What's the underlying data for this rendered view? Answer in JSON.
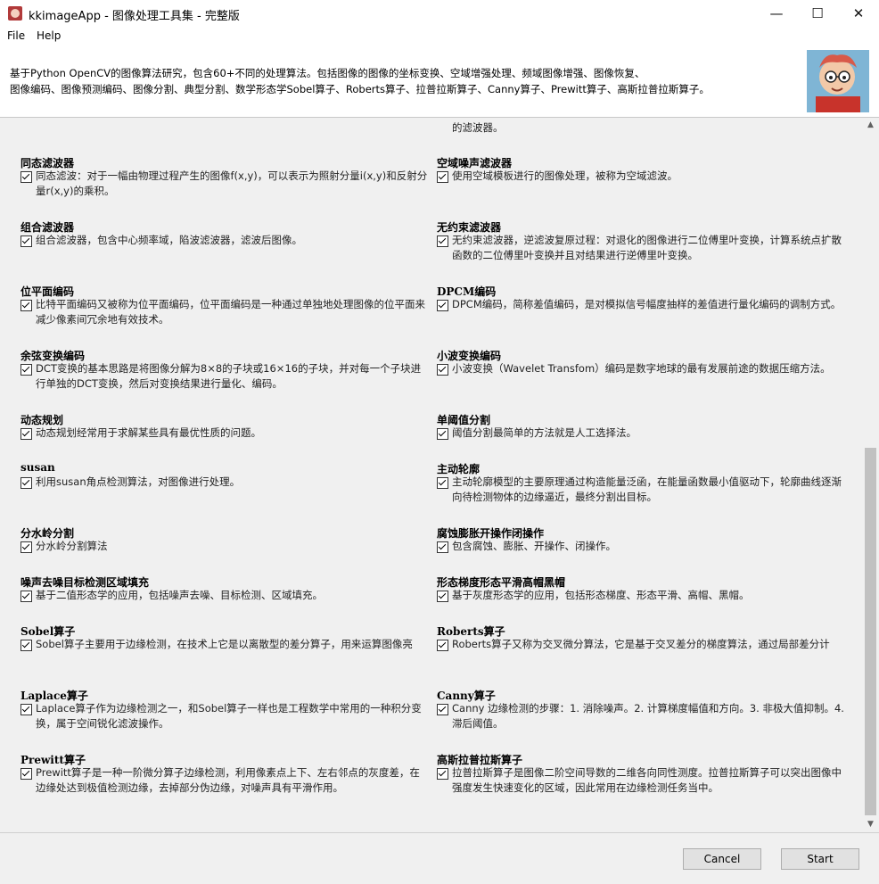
{
  "window": {
    "title": "kkimageApp - 图像处理工具集 - 完整版",
    "minimize": "—",
    "maximize": "☐",
    "close": "✕"
  },
  "menu": {
    "file": "File",
    "help": "Help"
  },
  "description": {
    "line1": "基于Python OpenCV的图像算法研究，包含60+不同的处理算法。包括图像的图像的坐标变换、空域增强处理、频域图像增强、图像恢复、",
    "line2": "图像编码、图像预测编码、图像分割、典型分割、数学形态学Sobel算子、Roberts算子、拉普拉斯算子、Canny算子、Prewitt算子、高斯拉普拉斯算子。"
  },
  "partial_top": "的滤波器。",
  "items_left": [
    {
      "heading": "同态滤波器",
      "text": "同态滤波：对于一幅由物理过程产生的图像f(x,y)，可以表示为照射分量i(x,y)和反射分量r(x,y)的乘积。"
    },
    {
      "heading": "组合滤波器",
      "text": "组合滤波器，包含中心频率域，陷波滤波器，滤波后图像。"
    },
    {
      "heading": "位平面编码",
      "text": "比特平面编码又被称为位平面编码，位平面编码是一种通过单独地处理图像的位平面来减少像素间冗余地有效技术。"
    },
    {
      "heading": "余弦变换编码",
      "text": "DCT变换的基本思路是将图像分解为8×8的子块或16×16的子块，并对每一个子块进行单独的DCT变换，然后对变换结果进行量化、编码。"
    },
    {
      "heading": "动态规划",
      "text": "动态规划经常用于求解某些具有最优性质的问题。"
    },
    {
      "heading": "susan",
      "text": "利用susan角点检测算法，对图像进行处理。"
    },
    {
      "heading": "分水岭分割",
      "text": "分水岭分割算法"
    },
    {
      "heading": "噪声去噪目标检测区域填充",
      "text": "基于二值形态学的应用，包括噪声去噪、目标检测、区域填充。"
    },
    {
      "heading": "Sobel算子",
      "text": "Sobel算子主要用于边缘检测，在技术上它是以离散型的差分算子，用来运算图像亮"
    },
    {
      "heading": "Laplace算子",
      "text": "Laplace算子作为边缘检测之一，和Sobel算子一样也是工程数学中常用的一种积分变换，属于空间锐化滤波操作。"
    },
    {
      "heading": "Prewitt算子",
      "text": "Prewitt算子是一种一阶微分算子边缘检测，利用像素点上下、左右邻点的灰度差，在边缘处达到极值检测边缘，去掉部分伪边缘，对噪声具有平滑作用。"
    }
  ],
  "items_right": [
    {
      "heading": "空域噪声滤波器",
      "text": "使用空域模板进行的图像处理，被称为空域滤波。"
    },
    {
      "heading": "无约束滤波器",
      "text": "无约束滤波器，逆滤波复原过程：对退化的图像进行二位傅里叶变换，计算系统点扩散函数的二位傅里叶变换并且对结果进行逆傅里叶变换。"
    },
    {
      "heading": "DPCM编码",
      "text": "DPCM编码，简称差值编码，是对模拟信号幅度抽样的差值进行量化编码的调制方式。"
    },
    {
      "heading": "小波变换编码",
      "text": "小波变换（Wavelet Transfom）编码是数字地球的最有发展前途的数据压缩方法。"
    },
    {
      "heading": "单阈值分割",
      "text": "阈值分割最简单的方法就是人工选择法。"
    },
    {
      "heading": "主动轮廓",
      "text": "主动轮廓模型的主要原理通过构造能量泛函，在能量函数最小值驱动下，轮廓曲线逐渐向待检测物体的边缘逼近，最终分割出目标。"
    },
    {
      "heading": "腐蚀膨胀开操作闭操作",
      "text": "包含腐蚀、膨胀、开操作、闭操作。"
    },
    {
      "heading": "形态梯度形态平滑高帽黑帽",
      "text": "基于灰度形态学的应用，包括形态梯度、形态平滑、高帽、黑帽。"
    },
    {
      "heading": "Roberts算子",
      "text": "Roberts算子又称为交叉微分算法，它是基于交叉差分的梯度算法，通过局部差分计"
    },
    {
      "heading": "Canny算子",
      "text": "Canny 边缘检测的步骤：1. 消除噪声。2. 计算梯度幅值和方向。3. 非极大值抑制。4. 滞后阈值。"
    },
    {
      "heading": "高斯拉普拉斯算子",
      "text": "拉普拉斯算子是图像二阶空间导数的二维各向同性测度。拉普拉斯算子可以突出图像中强度发生快速变化的区域，因此常用在边缘检测任务当中。"
    }
  ],
  "buttons": {
    "cancel": "Cancel",
    "start": "Start"
  },
  "scrollbar": {
    "up": "▲",
    "down": "▼"
  }
}
